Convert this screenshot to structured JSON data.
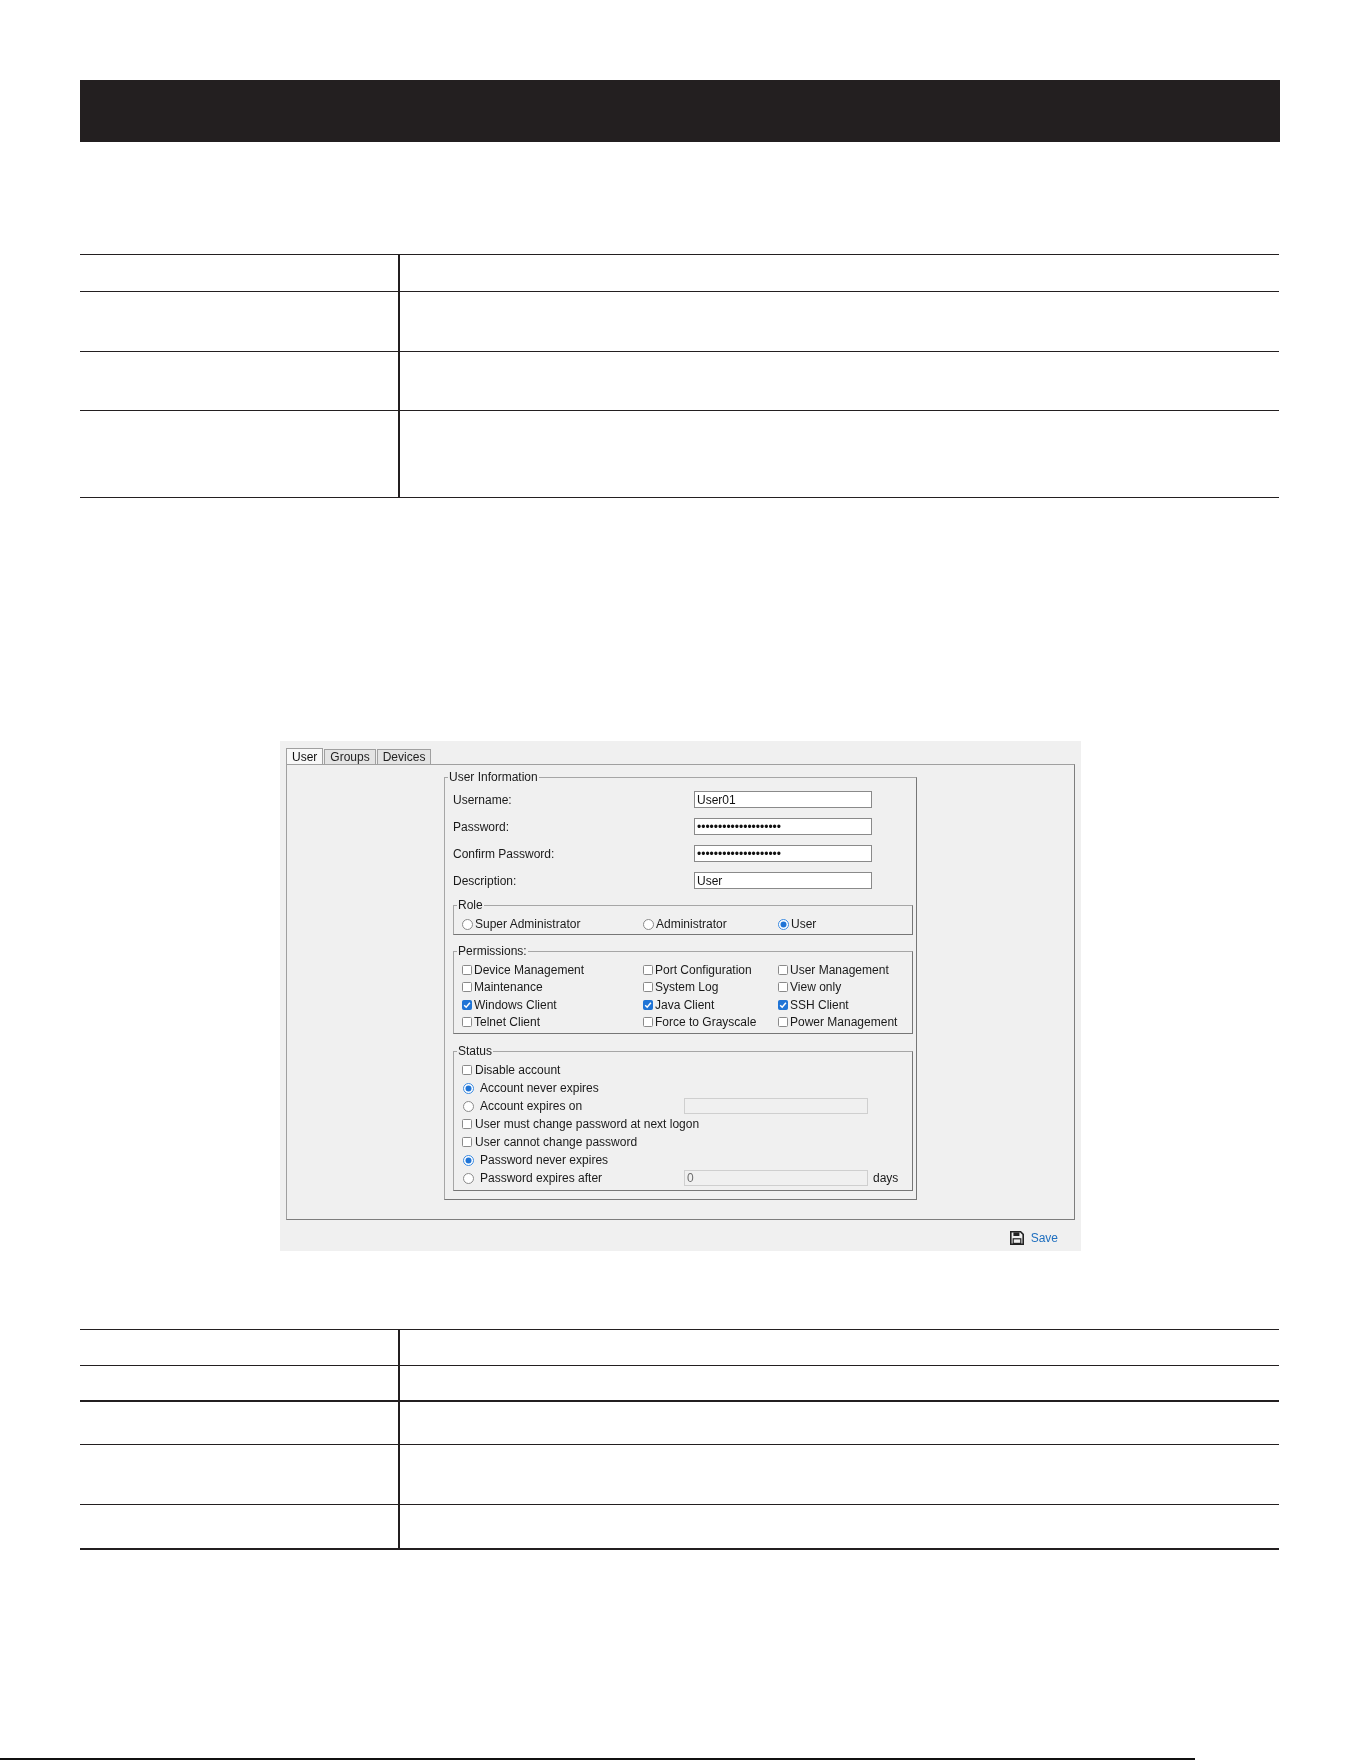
{
  "dialog": {
    "tabs": [
      {
        "label": "User",
        "selected": true
      },
      {
        "label": "Groups",
        "selected": false
      },
      {
        "label": "Devices",
        "selected": false
      }
    ],
    "user_information": {
      "legend": "User Information",
      "fields": [
        {
          "label": "Username:",
          "value": "User01"
        },
        {
          "label": "Password:",
          "value": "••••••••••••••••••••"
        },
        {
          "label": "Confirm Password:",
          "value": "••••••••••••••••••••"
        },
        {
          "label": "Description:",
          "value": "User"
        }
      ]
    },
    "role": {
      "legend": "Role",
      "options": [
        {
          "label": "Super Administrator",
          "selected": false
        },
        {
          "label": "Administrator",
          "selected": false
        },
        {
          "label": "User",
          "selected": true
        }
      ]
    },
    "permissions": {
      "legend": "Permissions:",
      "items": [
        {
          "label": "Device Management",
          "checked": false
        },
        {
          "label": "Port Configuration",
          "checked": false
        },
        {
          "label": "User Management",
          "checked": false
        },
        {
          "label": "Maintenance",
          "checked": false
        },
        {
          "label": "System Log",
          "checked": false
        },
        {
          "label": "View only",
          "checked": false
        },
        {
          "label": "Windows Client",
          "checked": true
        },
        {
          "label": "Java Client",
          "checked": true
        },
        {
          "label": "SSH Client",
          "checked": true
        },
        {
          "label": "Telnet Client",
          "checked": false
        },
        {
          "label": "Force to Grayscale",
          "checked": false
        },
        {
          "label": "Power Management",
          "checked": false
        }
      ]
    },
    "status": {
      "legend": "Status",
      "items": [
        {
          "kind": "checkbox",
          "label": "Disable account",
          "checked": false
        },
        {
          "kind": "radio",
          "label": "Account never expires",
          "selected": true
        },
        {
          "kind": "radio",
          "label": "Account expires on",
          "selected": false,
          "field": {
            "disabled": true
          }
        },
        {
          "kind": "checkbox",
          "label": "User must change password at next logon",
          "checked": false
        },
        {
          "kind": "checkbox",
          "label": "User cannot change password",
          "checked": false
        },
        {
          "kind": "radio",
          "label": "Password never expires",
          "selected": true
        },
        {
          "kind": "radio",
          "label": "Password expires after",
          "selected": false,
          "field": {
            "value": "0",
            "disabled": true
          },
          "suffix": "days"
        }
      ]
    },
    "save_button": {
      "label": "Save"
    }
  }
}
